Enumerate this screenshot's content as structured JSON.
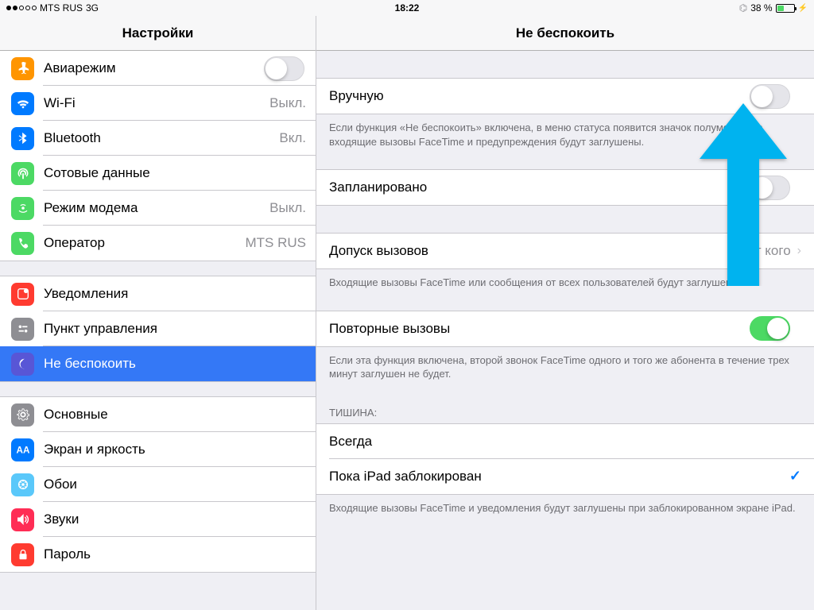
{
  "statusbar": {
    "carrier": "MTS RUS",
    "network": "3G",
    "time": "18:22",
    "battery_pct": "38 %"
  },
  "sidebar": {
    "title": "Настройки",
    "groups": [
      [
        {
          "key": "airplane",
          "label": "Авиарежим",
          "value": "",
          "type": "toggle",
          "on": false,
          "icon": "airplane",
          "bg": "#ff9500"
        },
        {
          "key": "wifi",
          "label": "Wi-Fi",
          "value": "Выкл.",
          "type": "link",
          "icon": "wifi",
          "bg": "#007aff"
        },
        {
          "key": "bluetooth",
          "label": "Bluetooth",
          "value": "Вкл.",
          "type": "link",
          "icon": "bluetooth",
          "bg": "#007aff"
        },
        {
          "key": "cellular",
          "label": "Сотовые данные",
          "value": "",
          "type": "link",
          "icon": "antenna",
          "bg": "#4cd964"
        },
        {
          "key": "hotspot",
          "label": "Режим модема",
          "value": "Выкл.",
          "type": "link",
          "icon": "hotspot",
          "bg": "#4cd964"
        },
        {
          "key": "carrier",
          "label": "Оператор",
          "value": "MTS RUS",
          "type": "link",
          "icon": "phone",
          "bg": "#4cd964"
        }
      ],
      [
        {
          "key": "notifications",
          "label": "Уведомления",
          "value": "",
          "type": "link",
          "icon": "notif",
          "bg": "#ff3b30"
        },
        {
          "key": "controlcenter",
          "label": "Пункт управления",
          "value": "",
          "type": "link",
          "icon": "control",
          "bg": "#8e8e93"
        },
        {
          "key": "dnd",
          "label": "Не беспокоить",
          "value": "",
          "type": "link",
          "icon": "moon",
          "bg": "#5856d6",
          "selected": true
        }
      ],
      [
        {
          "key": "general",
          "label": "Основные",
          "value": "",
          "type": "link",
          "icon": "gear",
          "bg": "#8e8e93"
        },
        {
          "key": "display",
          "label": "Экран и яркость",
          "value": "",
          "type": "link",
          "icon": "display",
          "bg": "#007aff"
        },
        {
          "key": "wallpaper",
          "label": "Обои",
          "value": "",
          "type": "link",
          "icon": "wallpaper",
          "bg": "#5ac8fa"
        },
        {
          "key": "sounds",
          "label": "Звуки",
          "value": "",
          "type": "link",
          "icon": "sounds",
          "bg": "#ff2d55"
        },
        {
          "key": "passcode",
          "label": "Пароль",
          "value": "",
          "type": "link",
          "icon": "lock",
          "bg": "#ff3b30"
        }
      ]
    ]
  },
  "detail": {
    "title": "Не беспокоить",
    "manual": {
      "label": "Вручную",
      "on": false,
      "footer": "Если функция «Не беспокоить» включена, в меню статуса появится значок полумесяца, а входящие вызовы FaceTime и предупреждения будут заглушены."
    },
    "scheduled": {
      "label": "Запланировано",
      "on": false
    },
    "allow": {
      "label": "Допуск вызовов",
      "value": "Ни от кого",
      "footer": "Входящие вызовы FaceTime или сообщения от всех пользователей будут заглушены."
    },
    "repeated": {
      "label": "Повторные вызовы",
      "on": true,
      "footer": "Если эта функция включена, второй звонок FaceTime одного и того же абонента в течение трех минут заглушен не будет."
    },
    "silence": {
      "header": "ТИШИНА:",
      "options": [
        {
          "label": "Всегда",
          "checked": false
        },
        {
          "label": "Пока iPad заблокирован",
          "checked": true
        }
      ],
      "footer": "Входящие вызовы FaceTime и уведомления будут заглушены при заблокированном экране iPad."
    }
  }
}
